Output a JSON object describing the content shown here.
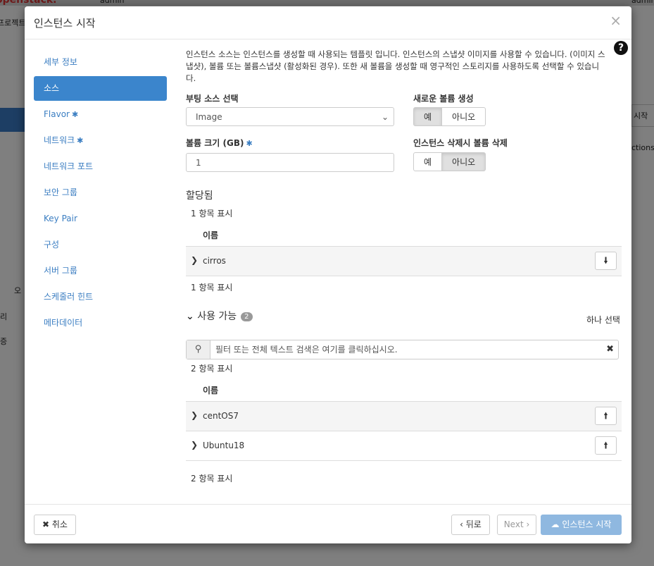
{
  "background": {
    "brand": "openstack.",
    "project_menu": "admin",
    "user_menu": "admin",
    "side_texts": [
      "프로젝트",
      "오",
      "리",
      "증"
    ],
    "right_texts": [
      "시작",
      "ctions"
    ]
  },
  "modal": {
    "title": "인스턴스 시작",
    "close_symbol": "×",
    "help_symbol": "?"
  },
  "sidebar": {
    "items": [
      {
        "label": "세부 정보",
        "required": false,
        "active": false
      },
      {
        "label": "소스",
        "required": false,
        "active": true
      },
      {
        "label": "Flavor",
        "required": true,
        "active": false
      },
      {
        "label": "네트워크",
        "required": true,
        "active": false
      },
      {
        "label": "네트워크 포트",
        "required": false,
        "active": false
      },
      {
        "label": "보안 그룹",
        "required": false,
        "active": false
      },
      {
        "label": "Key Pair",
        "required": false,
        "active": false
      },
      {
        "label": "구성",
        "required": false,
        "active": false
      },
      {
        "label": "서버 그룹",
        "required": false,
        "active": false
      },
      {
        "label": "스케줄러 힌트",
        "required": false,
        "active": false
      },
      {
        "label": "메타데이터",
        "required": false,
        "active": false
      }
    ],
    "required_symbol": "✱"
  },
  "source": {
    "description": "인스턴스 소스는 인스턴스를 생성할 때 사용되는 템플릿 입니다. 인스턴스의 스냅샷 이미지를 사용할 수 있습니다. (이미지 스냅샷), 볼륨 또는 볼륨스냅샷 (활성화된 경우). 또한 새 볼륨을 생성할 때 영구적인 스토리지를 사용하도록 선택할 수 있습니다.",
    "boot_source_label": "부팅 소스 선택",
    "boot_source_value": "Image",
    "new_volume_label": "새로운 볼륨 생성",
    "new_volume_yes": "예",
    "new_volume_no": "아니오",
    "new_volume_selected": "예",
    "volume_size_label": "볼륨 크기 (GB)",
    "volume_size_value": "1",
    "delete_volume_label": "인스턴스 삭제시 볼륨 삭제",
    "delete_volume_yes": "예",
    "delete_volume_no": "아니오",
    "delete_volume_selected": "아니오"
  },
  "allocated": {
    "title": "할당됨",
    "count_text": "1 항목 표시",
    "column_name": "이름",
    "rows": [
      {
        "name": "cirros"
      }
    ],
    "count_text_bottom": "1 항목 표시"
  },
  "available": {
    "title": "사용 가능",
    "badge": "2",
    "select_one": "하나 선택",
    "filter_placeholder": "필터 또는 전체 텍스트 검색은 여기를 클릭하십시오.",
    "count_text": "2 항목 표시",
    "column_name": "이름",
    "rows": [
      {
        "name": "centOS7"
      },
      {
        "name": "Ubuntu18"
      }
    ],
    "count_text_bottom": "2 항목 표시"
  },
  "footer": {
    "cancel": "취소",
    "back": "‹ 뒤로",
    "next": "Next ›",
    "launch": "인스턴스 시작"
  },
  "colors": {
    "accent": "#3b85cc",
    "link": "#3b7ec2",
    "launch_button": "#8fb8e0"
  }
}
